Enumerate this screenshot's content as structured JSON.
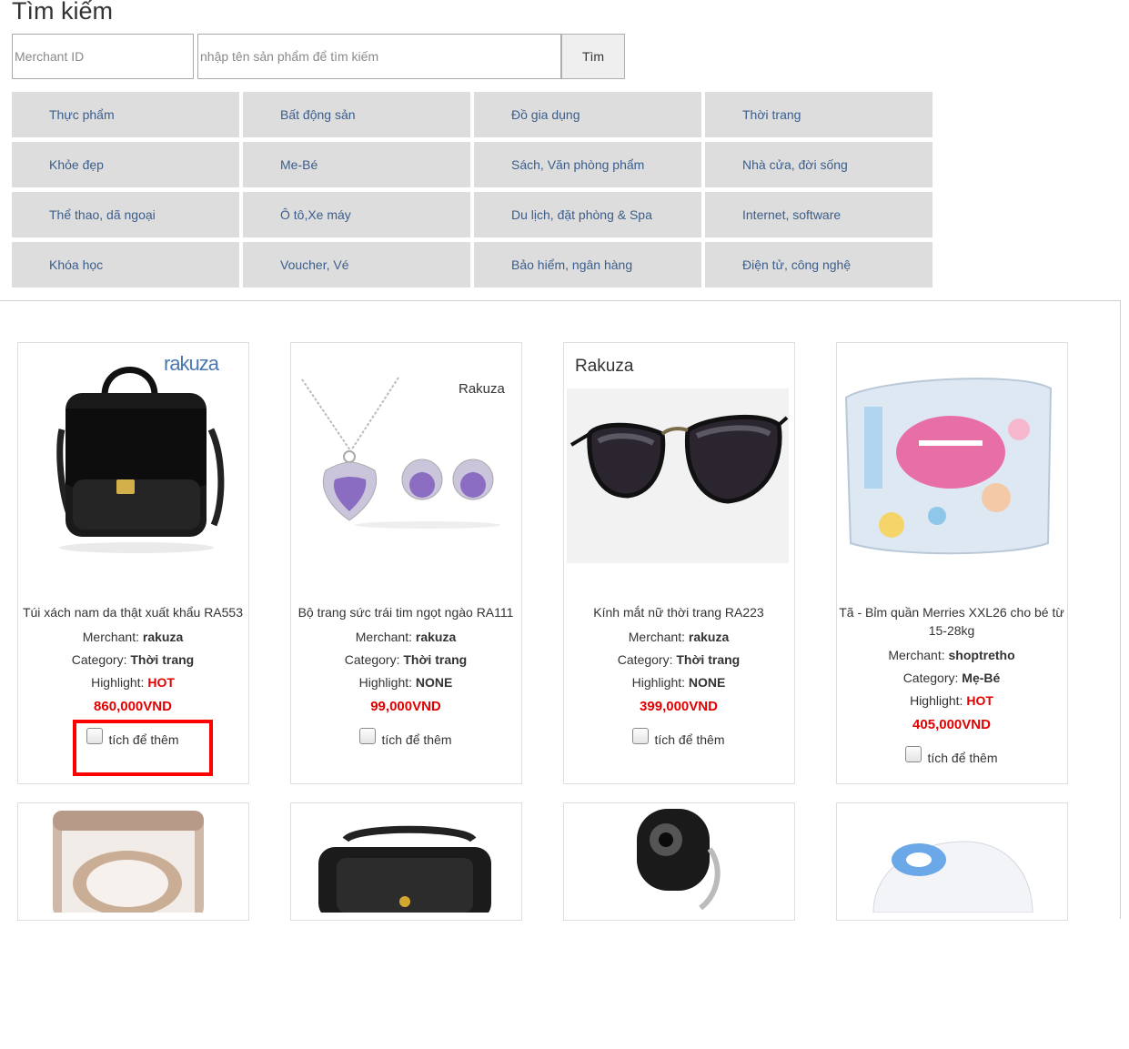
{
  "page": {
    "title": "Tìm kiếm"
  },
  "search": {
    "merchant_placeholder": "Merchant ID",
    "keyword_placeholder": "nhập tên sản phẩm để tìm kiếm",
    "button_label": "Tìm"
  },
  "categories": [
    "Thực phẩm",
    "Bất động sản",
    "Đồ gia dụng",
    "Thời trang",
    "Khỏe đẹp",
    "Me-Bé",
    "Sách, Văn phòng phẩm",
    "Nhà cửa, đời sống",
    "Thể thao, dã ngoại",
    "Ô tô,Xe máy",
    "Du lịch, đặt phòng & Spa",
    "Internet, software",
    "Khóa học",
    "Voucher, Vé",
    "Bảo hiểm, ngân hàng",
    "Điện tử, công nghệ"
  ],
  "labels": {
    "merchant": "Merchant:",
    "category": "Category:",
    "highlight": "Highlight:",
    "add": "tích để thêm"
  },
  "products": [
    {
      "name": "Túi xách nam da thật xuất khẩu RA553",
      "merchant": "rakuza",
      "category": "Thời trang",
      "highlight": "HOT",
      "price": "860,000VND",
      "brand": "rakuza",
      "image": "backpack-image"
    },
    {
      "name": "Bộ trang sức trái tim ngọt ngào RA111",
      "merchant": "rakuza",
      "category": "Thời trang",
      "highlight": "NONE",
      "price": "99,000VND",
      "brand": "Rakuza",
      "image": "jewelry-image"
    },
    {
      "name": "Kính mắt nữ thời trang RA223",
      "merchant": "rakuza",
      "category": "Thời trang",
      "highlight": "NONE",
      "price": "399,000VND",
      "brand": "Rakuza",
      "image": "sunglasses-image"
    },
    {
      "name": "Tã - Bỉm quần Merries XXL26 cho bé từ 15-28kg",
      "merchant": "shoptretho",
      "category": "Mẹ-Bé",
      "highlight": "HOT",
      "price": "405,000VND",
      "brand": "",
      "image": "diapers-image"
    }
  ],
  "colors": {
    "hot": "#e20000",
    "category_bg": "#dddddd",
    "category_text": "#3b5e8c",
    "highlight_box": "#ff0000"
  }
}
